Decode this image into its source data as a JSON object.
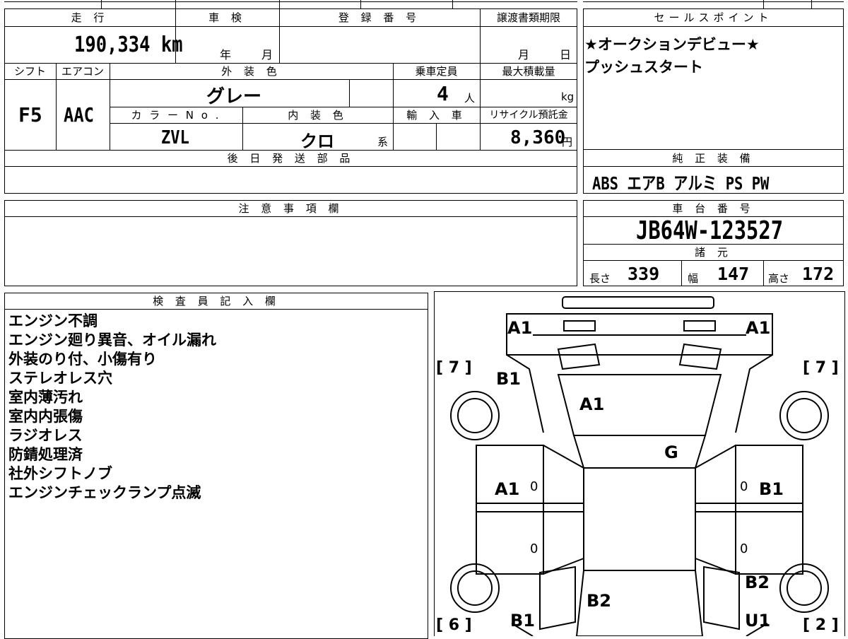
{
  "top_table": {
    "h_mileage": "走 行",
    "h_shaken": "車 検",
    "h_reg": "登 録 番 号",
    "h_transfer": "譲渡書類期限",
    "mileage": "190,334 km",
    "shaken_year": "年",
    "shaken_month": "月",
    "transfer_month": "月",
    "transfer_day": "日",
    "h_shift": "シフト",
    "h_ac": "エアコン",
    "h_exterior": "外 装 色",
    "h_capacity": "乗車定員",
    "h_load": "最大積載量",
    "shift": "F5",
    "ac": "AAC",
    "exterior": "グレー",
    "capacity": "4",
    "capacity_unit": "人",
    "load_unit": "kg",
    "h_color_no": "カ ラ ー N o .",
    "h_interior": "内 装 色",
    "h_import": "輸 入 車",
    "h_recycle": "リサイクル預託金",
    "color_no": "ZVL",
    "interior": "クロ",
    "interior_suffix": "系",
    "recycle": "8,360",
    "recycle_unit": "円",
    "h_later": "後 日 発 送 部 品"
  },
  "sales": {
    "header": "セールスポイント",
    "line1": "★オークションデビュー★",
    "line2": "プッシュスタート"
  },
  "equipment": {
    "header": "純 正 装 備",
    "value": "ABS エアB アルミ PS PW"
  },
  "caution": {
    "header": "注 意 事 項 欄"
  },
  "chassis": {
    "header": "車 台 番 号",
    "value": "JB64W-123527",
    "spec_header": "諸 元",
    "len_label": "長さ",
    "len_value": "339",
    "width_label": "幅",
    "width_value": "147",
    "height_label": "高さ",
    "height_value": "172"
  },
  "inspector": {
    "header": "検 査 員 記 入 欄",
    "notes": [
      "エンジン不調",
      "エンジン廻り異音、オイル漏れ",
      "外装のり付、小傷有り",
      "ステレオレス穴",
      "室内薄汚れ",
      "室内内張傷",
      "ラジオレス",
      "防錆処理済",
      "社外シフトノブ",
      "エンジンチェックランプ点滅"
    ]
  },
  "diagram": {
    "a1_left": "A1",
    "a1_right": "A1",
    "b1_front_left": "B1",
    "a1_hood": "A1",
    "g_glass": "G",
    "a1_door_left": "A1",
    "b1_door_right": "B1",
    "zero_1": "0",
    "zero_2": "0",
    "zero_3": "0",
    "zero_4": "0",
    "b2_rear_right": "B2",
    "b2_tail": "B2",
    "b1_rear_left": "B1",
    "u1_rear_right": "U1",
    "tire_fl": "[ 7 ]",
    "tire_fr": "[ 7 ]",
    "tire_rl": "[ 6 ]",
    "tire_rr": "[ 2 ]"
  }
}
